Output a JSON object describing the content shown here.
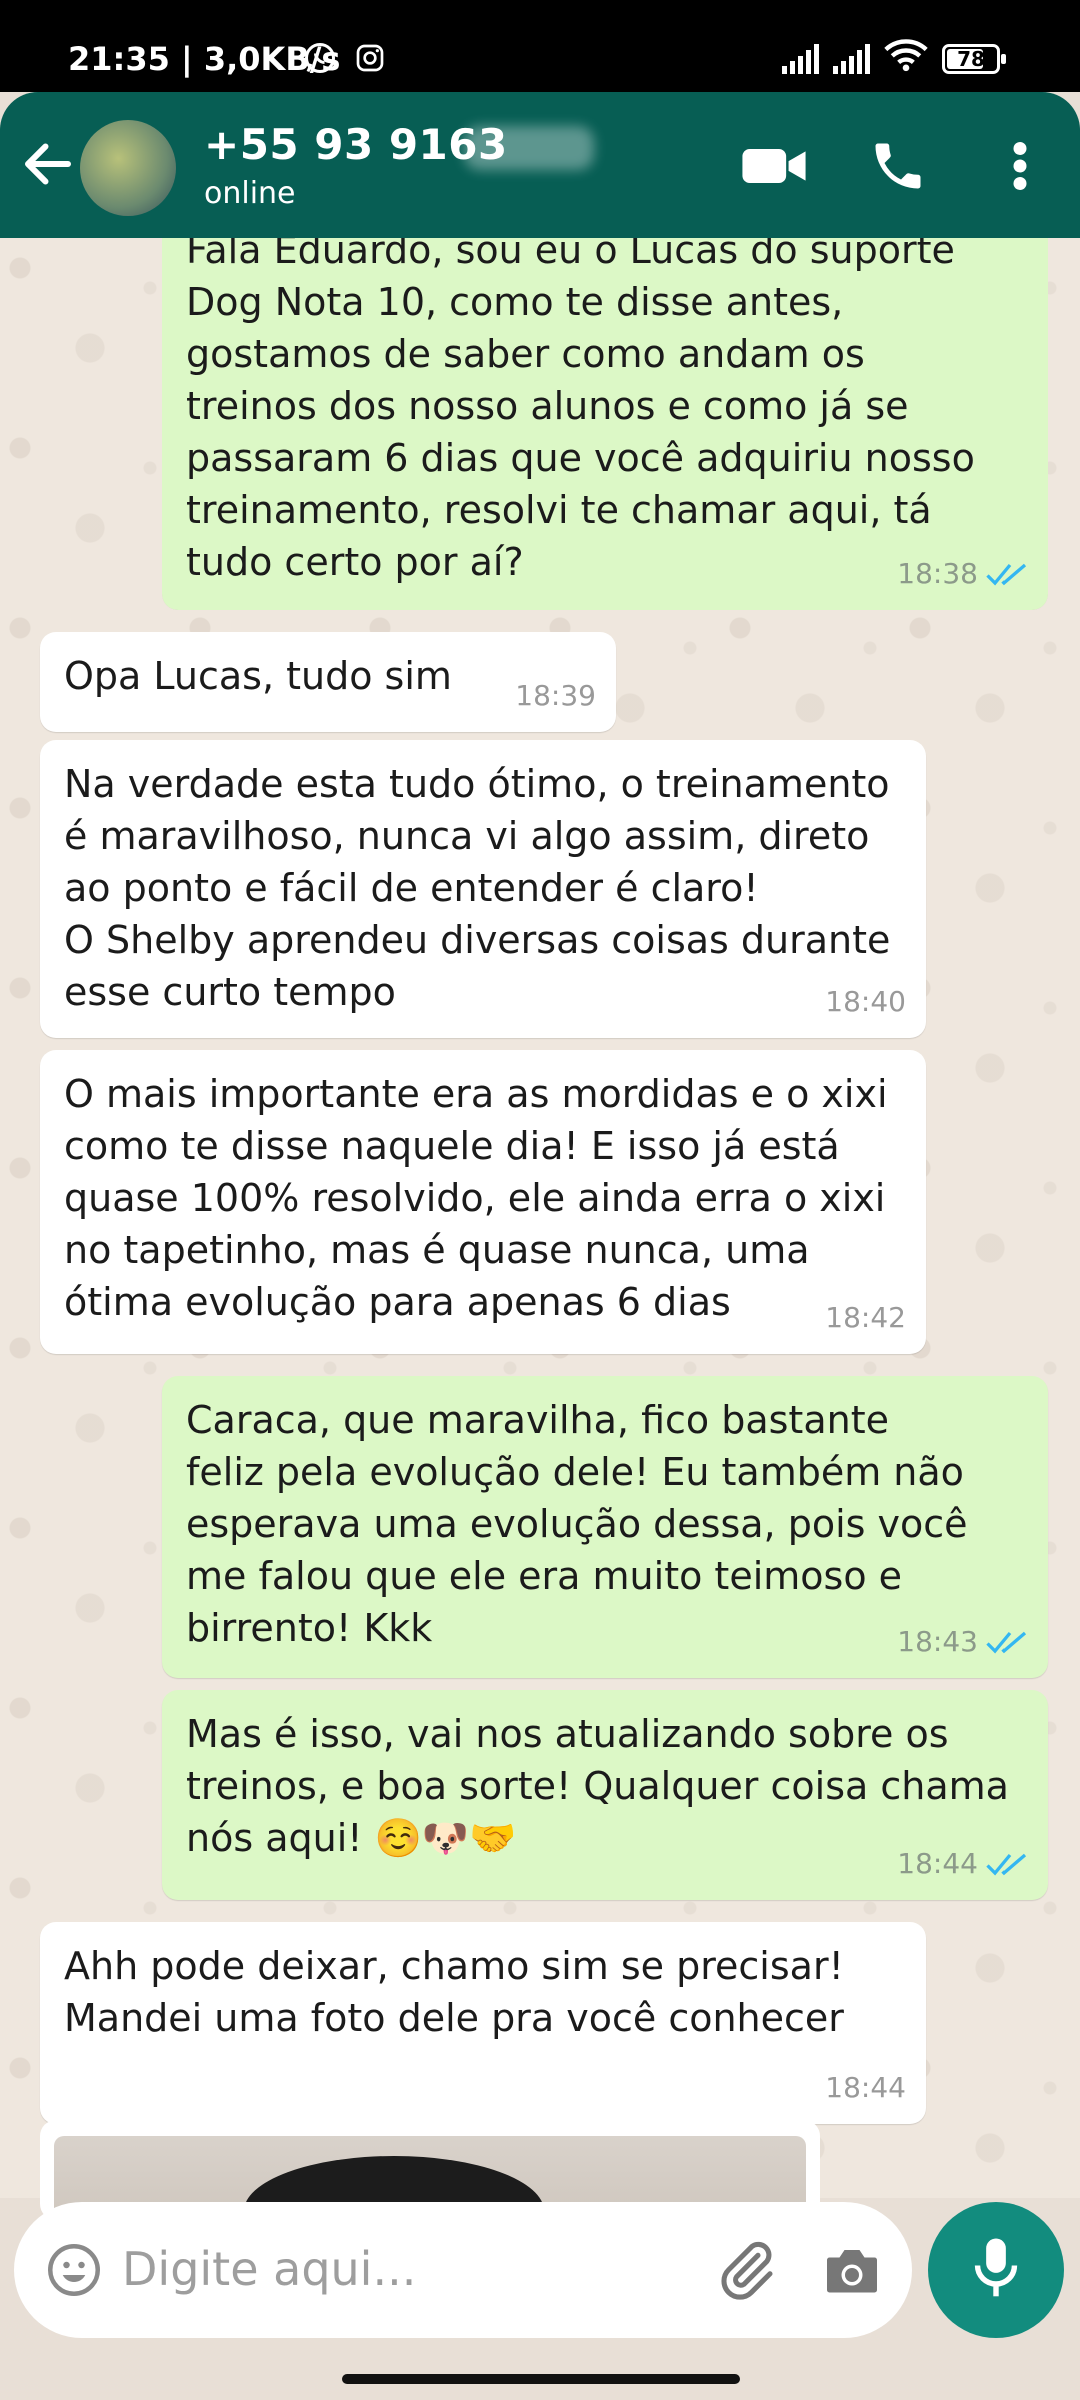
{
  "status_bar": {
    "time_speed": "21:35 | 3,0KB/s",
    "battery": "78"
  },
  "header": {
    "contact_name": "+55 93 9163",
    "status": "online"
  },
  "messages": [
    {
      "direction": "out",
      "text": "Fala Eduardo, sou eu o Lucas do suporte\nDog Nota 10, como te disse antes,\ngostamos de saber como andam os\ntreinos dos nosso alunos e como já se\npassaram 6 dias que você adquiriu nosso\ntreinamento, resolvi te chamar aqui, tá\ntudo certo por aí?",
      "time": "18:38",
      "read": true
    },
    {
      "direction": "in",
      "text": "Opa Lucas, tudo sim",
      "time": "18:39"
    },
    {
      "direction": "in",
      "text": "Na verdade esta tudo ótimo, o treinamento\né maravilhoso, nunca vi algo assim, direto\nao ponto e fácil de entender é claro!\nO Shelby aprendeu diversas coisas durante\nesse curto tempo",
      "time": "18:40"
    },
    {
      "direction": "in",
      "text": "O mais importante era as mordidas e o xixi\ncomo te disse naquele dia! E isso já está\nquase 100% resolvido, ele ainda erra o xixi\nno tapetinho, mas é quase nunca, uma\nótima evolução para apenas 6 dias",
      "time": "18:42"
    },
    {
      "direction": "out",
      "text": "Caraca, que maravilha, fico bastante\nfeliz pela evolução dele! Eu também não\nesperava uma evolução dessa, pois você\nme falou que ele era muito teimoso e\nbirrento! Kkk",
      "time": "18:43",
      "read": true
    },
    {
      "direction": "out",
      "text": "Mas é isso, vai nos atualizando sobre os\ntreinos, e boa sorte! Qualquer coisa chama\nnós aqui! ☺️🐶🤝",
      "time": "18:44",
      "read": true
    },
    {
      "direction": "in",
      "text": "Ahh pode deixar, chamo sim se precisar!\nMandei uma foto dele pra você conhecer",
      "time": "18:44"
    }
  ],
  "composer": {
    "placeholder": "Digite aqui..."
  },
  "colors": {
    "header": "#075e54",
    "outgoing_bubble": "#dcf8c6",
    "incoming_bubble": "#ffffff",
    "read_ticks": "#34b7f1",
    "mic_button": "#128c7e"
  }
}
